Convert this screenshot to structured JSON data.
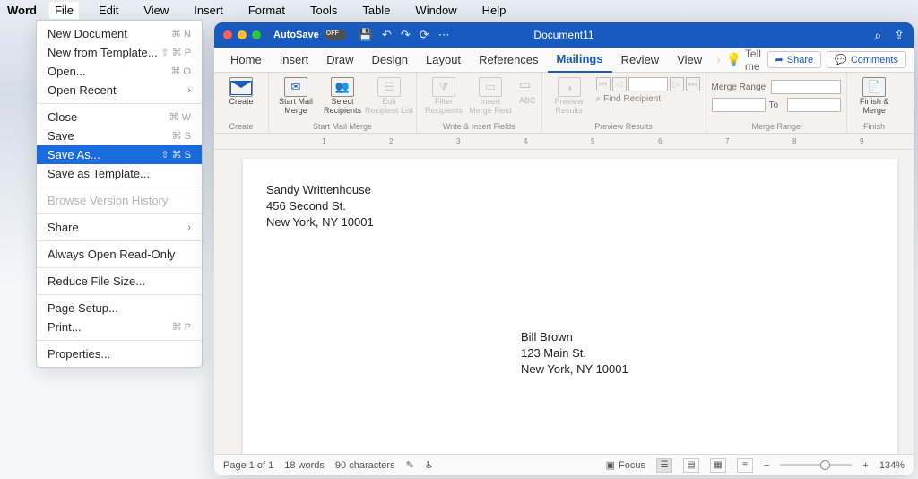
{
  "menubar": {
    "app": "Word",
    "items": [
      "File",
      "Edit",
      "View",
      "Insert",
      "Format",
      "Tools",
      "Table",
      "Window",
      "Help"
    ],
    "open_index": 0
  },
  "file_menu": [
    {
      "label": "New Document",
      "shortcut": "⌘ N",
      "kind": "item"
    },
    {
      "label": "New from Template...",
      "shortcut": "⇧ ⌘ P",
      "kind": "item"
    },
    {
      "label": "Open...",
      "shortcut": "⌘ O",
      "kind": "item"
    },
    {
      "label": "Open Recent",
      "shortcut": "",
      "kind": "submenu"
    },
    {
      "kind": "sep"
    },
    {
      "label": "Close",
      "shortcut": "⌘ W",
      "kind": "item"
    },
    {
      "label": "Save",
      "shortcut": "⌘ S",
      "kind": "item"
    },
    {
      "label": "Save As...",
      "shortcut": "⇧ ⌘ S",
      "kind": "item",
      "highlight": true
    },
    {
      "label": "Save as Template...",
      "shortcut": "",
      "kind": "item"
    },
    {
      "kind": "sep"
    },
    {
      "label": "Browse Version History",
      "shortcut": "",
      "kind": "item",
      "disabled": true
    },
    {
      "kind": "sep"
    },
    {
      "label": "Share",
      "shortcut": "",
      "kind": "submenu"
    },
    {
      "kind": "sep"
    },
    {
      "label": "Always Open Read-Only",
      "shortcut": "",
      "kind": "item"
    },
    {
      "kind": "sep"
    },
    {
      "label": "Reduce File Size...",
      "shortcut": "",
      "kind": "item"
    },
    {
      "kind": "sep"
    },
    {
      "label": "Page Setup...",
      "shortcut": "",
      "kind": "item"
    },
    {
      "label": "Print...",
      "shortcut": "⌘ P",
      "kind": "item"
    },
    {
      "kind": "sep"
    },
    {
      "label": "Properties...",
      "shortcut": "",
      "kind": "item"
    }
  ],
  "window": {
    "autosave": "AutoSave",
    "doc_title": "Document11",
    "tabs": [
      "Home",
      "Insert",
      "Draw",
      "Design",
      "Layout",
      "References",
      "Mailings",
      "Review",
      "View"
    ],
    "active_tab": 6,
    "tellme": "Tell me",
    "share": "Share",
    "comments": "Comments"
  },
  "ribbon": {
    "g1": {
      "label": "Create",
      "b1": "Create"
    },
    "g2": {
      "label": "Start Mail Merge",
      "b1": "Start Mail\nMerge",
      "b2": "Select\nRecipients",
      "b3": "Edit\nRecipient List"
    },
    "g3": {
      "label": "Write & Insert Fields",
      "b1": "Filter\nRecipients",
      "b2": "Insert\nMerge Field"
    },
    "g4": {
      "label": "Preview Results",
      "b1": "Preview\nResults",
      "find": "Find Recipient"
    },
    "g5": {
      "label": "Merge Range",
      "title": "Merge Range",
      "to": "To"
    },
    "g6": {
      "label": "Finish",
      "b1": "Finish &\nMerge"
    }
  },
  "ruler_ticks": [
    "1",
    "2",
    "3",
    "4",
    "5",
    "6",
    "7",
    "8",
    "9"
  ],
  "doc": {
    "ret_name": "Sandy Writtenhouse",
    "ret_street": "456 Second St.",
    "ret_city": "New York, NY 10001",
    "to_name": "Bill Brown",
    "to_street": "123 Main St.",
    "to_city": "New York, NY 10001"
  },
  "status": {
    "page": "Page 1 of 1",
    "words": "18 words",
    "chars": "90 characters",
    "focus": "Focus",
    "zoom": "134%"
  }
}
